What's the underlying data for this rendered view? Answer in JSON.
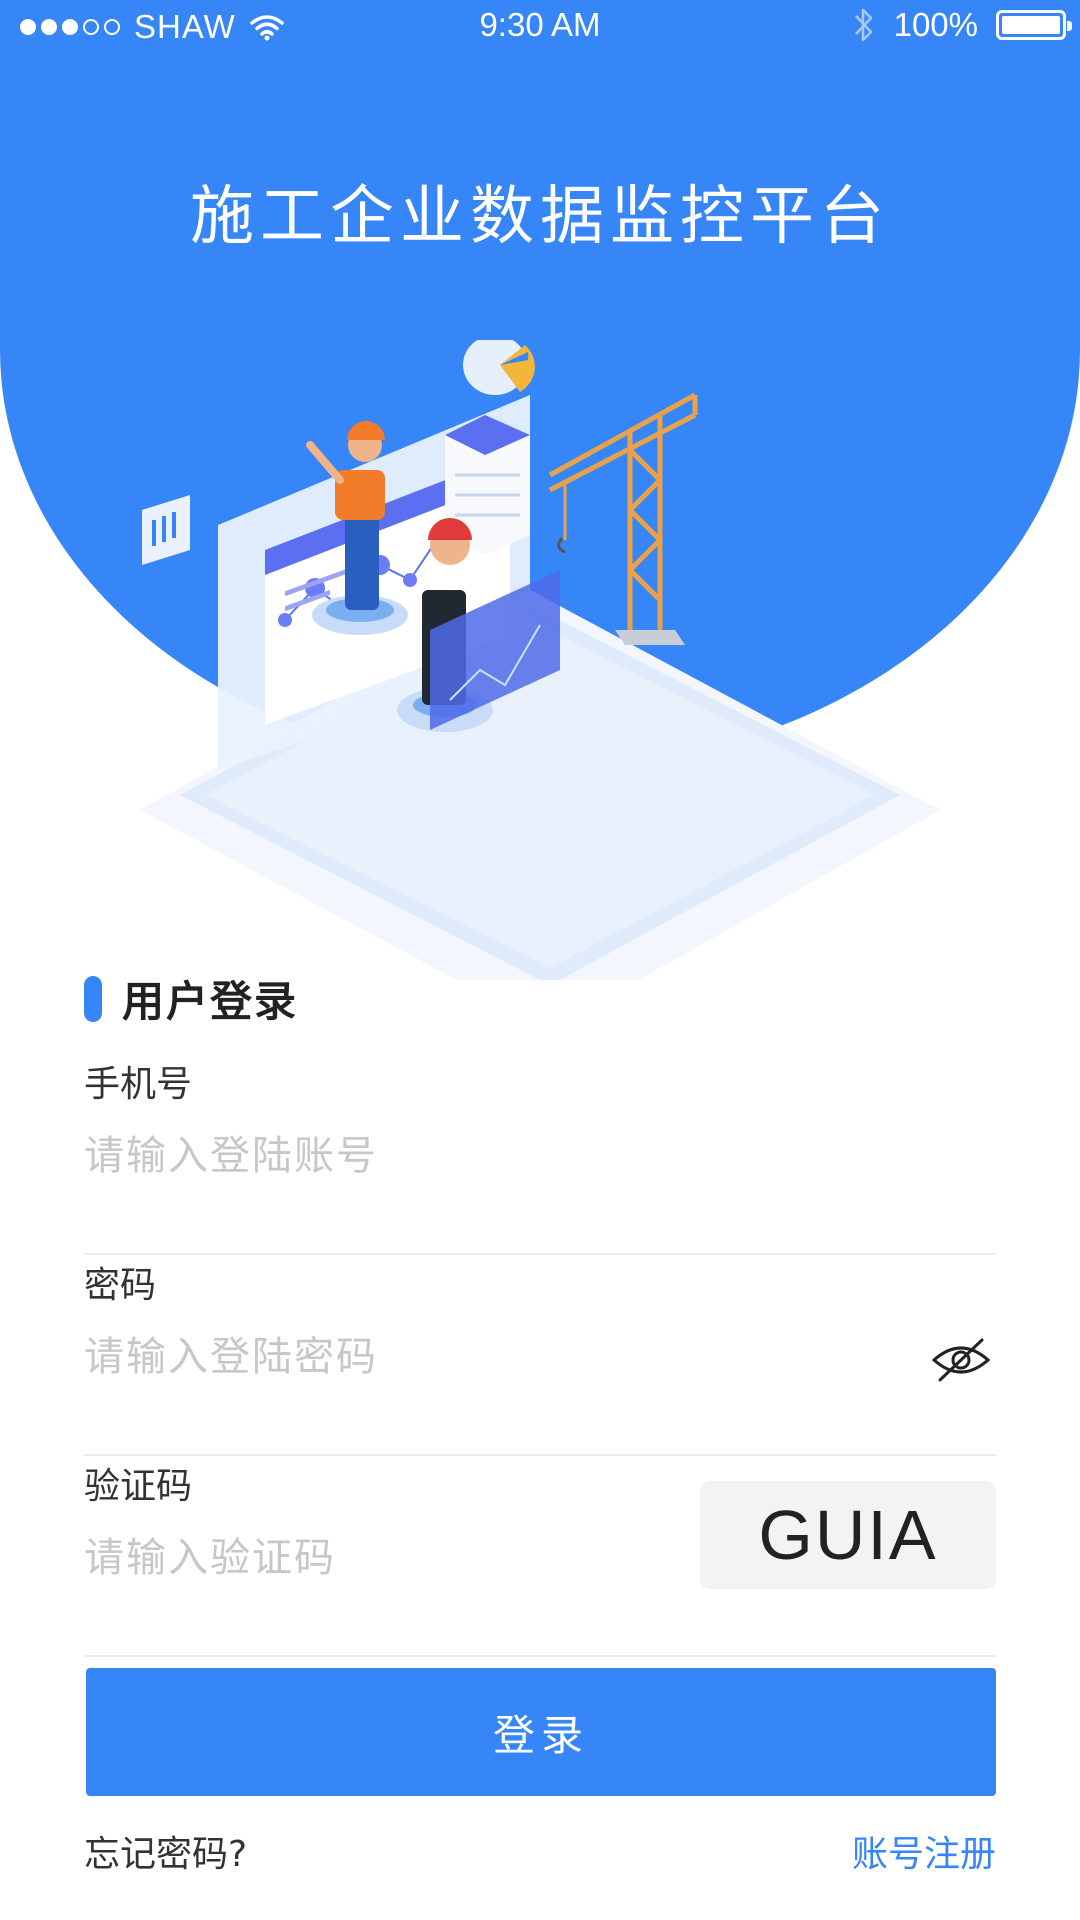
{
  "status_bar": {
    "carrier": "SHAW",
    "time": "9:30 AM",
    "battery": "100%",
    "signal_bars_filled": 3,
    "signal_bars_total": 5,
    "wifi_icon": "wifi-icon",
    "bluetooth_icon": "bluetooth-icon"
  },
  "header": {
    "title": "施工企业数据监控平台"
  },
  "login": {
    "section_title": "用户登录",
    "phone": {
      "label": "手机号",
      "placeholder": "请输入登陆账号",
      "value": ""
    },
    "password": {
      "label": "密码",
      "placeholder": "请输入登陆密码",
      "value": "",
      "toggle_icon": "eye-hidden-icon"
    },
    "captcha": {
      "label": "验证码",
      "placeholder": "请输入验证码",
      "value": "",
      "code": "GUIA"
    },
    "submit_label": "登录",
    "forgot_label": "忘记密码?",
    "register_label": "账号注册"
  },
  "colors": {
    "primary": "#3686f7",
    "placeholder": "#c7c7c7",
    "divider": "#ececec",
    "captcha_bg": "#f3f3f3"
  }
}
